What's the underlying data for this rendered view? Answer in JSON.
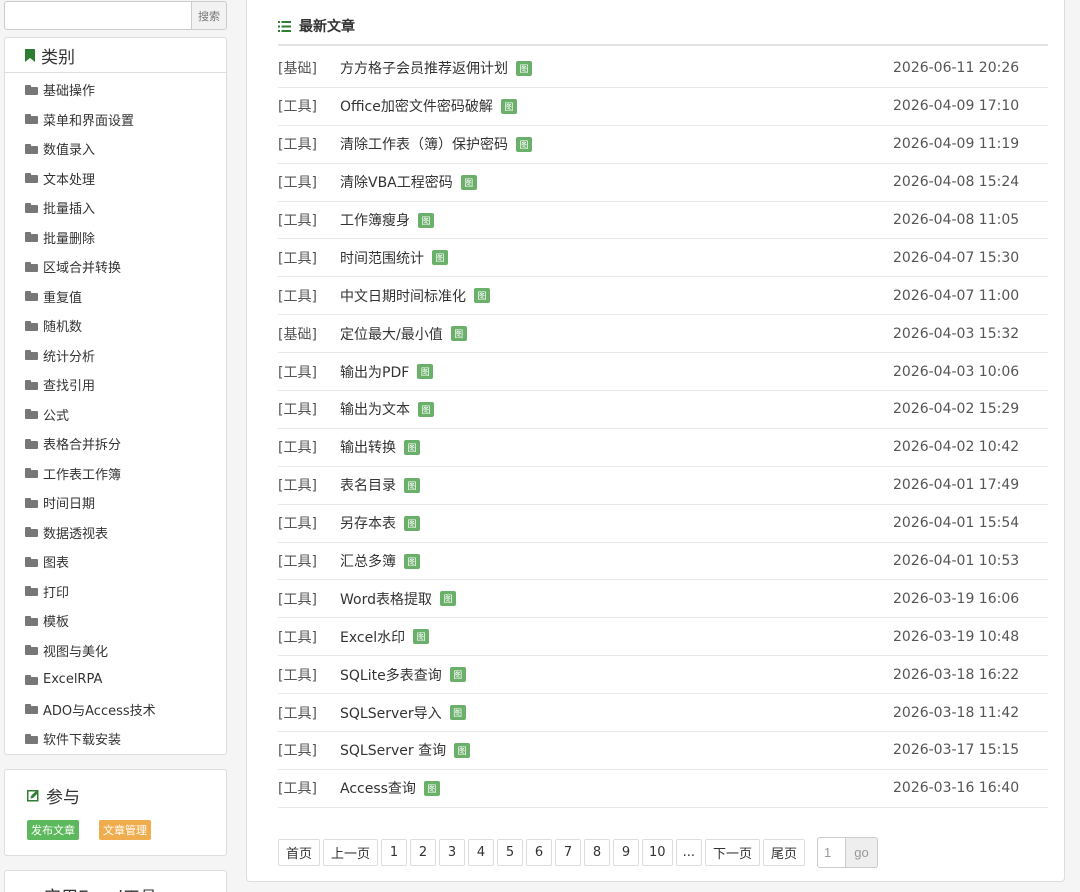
{
  "search": {
    "placeholder": "",
    "button": "搜索"
  },
  "categories": {
    "title": "类别",
    "items": [
      "基础操作",
      "菜单和界面设置",
      "数值录入",
      "文本处理",
      "批量插入",
      "批量删除",
      "区域合并转换",
      "重复值",
      "随机数",
      "统计分析",
      "查找引用",
      "公式",
      "表格合并拆分",
      "工作表工作簿",
      "时间日期",
      "数据透视表",
      "图表",
      "打印",
      "模板",
      "视图与美化",
      "ExcelRPA",
      "ADO与Access技术",
      "软件下载安装"
    ]
  },
  "participate": {
    "title": "参与",
    "publish": "发布文章",
    "manage": "文章管理"
  },
  "tools": {
    "title": "实用Excel工具"
  },
  "main": {
    "title": "最新文章",
    "img_label": "图",
    "articles": [
      {
        "cat": "[基础]",
        "title": "方方格子会员推荐返佣计划",
        "date": "2026-06-11 20:26"
      },
      {
        "cat": "[工具]",
        "title": "Office加密文件密码破解",
        "date": "2026-04-09 17:10"
      },
      {
        "cat": "[工具]",
        "title": "清除工作表（簿）保护密码",
        "date": "2026-04-09 11:19"
      },
      {
        "cat": "[工具]",
        "title": "清除VBA工程密码",
        "date": "2026-04-08 15:24"
      },
      {
        "cat": "[工具]",
        "title": "工作簿瘦身",
        "date": "2026-04-08 11:05"
      },
      {
        "cat": "[工具]",
        "title": "时间范围统计",
        "date": "2026-04-07 15:30"
      },
      {
        "cat": "[工具]",
        "title": "中文日期时间标准化",
        "date": "2026-04-07 11:00"
      },
      {
        "cat": "[基础]",
        "title": "定位最大/最小值",
        "date": "2026-04-03 15:32"
      },
      {
        "cat": "[工具]",
        "title": "输出为PDF",
        "date": "2026-04-03 10:06"
      },
      {
        "cat": "[工具]",
        "title": "输出为文本",
        "date": "2026-04-02 15:29"
      },
      {
        "cat": "[工具]",
        "title": "输出转换",
        "date": "2026-04-02 10:42"
      },
      {
        "cat": "[工具]",
        "title": "表名目录",
        "date": "2026-04-01 17:49"
      },
      {
        "cat": "[工具]",
        "title": "另存本表",
        "date": "2026-04-01 15:54"
      },
      {
        "cat": "[工具]",
        "title": "汇总多簿",
        "date": "2026-04-01 10:53"
      },
      {
        "cat": "[工具]",
        "title": "Word表格提取",
        "date": "2026-03-19 16:06"
      },
      {
        "cat": "[工具]",
        "title": "Excel水印",
        "date": "2026-03-19 10:48"
      },
      {
        "cat": "[工具]",
        "title": "SQLite多表查询",
        "date": "2026-03-18 16:22"
      },
      {
        "cat": "[工具]",
        "title": "SQLServer导入",
        "date": "2026-03-18 11:42"
      },
      {
        "cat": "[工具]",
        "title": "SQLServer 查询",
        "date": "2026-03-17 15:15"
      },
      {
        "cat": "[工具]",
        "title": "Access查询",
        "date": "2026-03-16 16:40"
      }
    ]
  },
  "pagination": {
    "first": "首页",
    "prev": "上一页",
    "pages": [
      "1",
      "2",
      "3",
      "4",
      "5",
      "6",
      "7",
      "8",
      "9",
      "10"
    ],
    "ellipsis": "...",
    "next": "下一页",
    "last": "尾页",
    "goto_value": "1",
    "go": "go"
  },
  "colors": {
    "badge_green": "#5cb85c",
    "badge_orange": "#f0ad4e",
    "img_badge": "#6ab06a",
    "bookmark": "#2e7d32"
  }
}
